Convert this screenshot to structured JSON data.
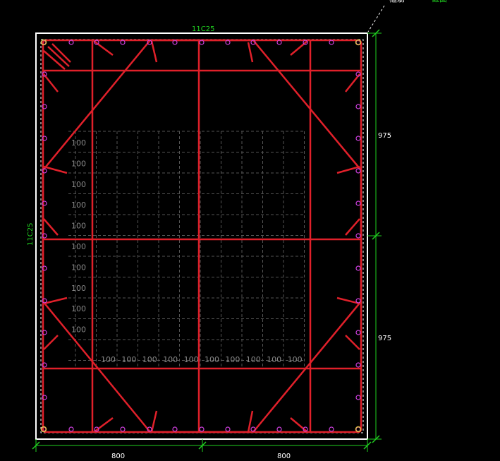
{
  "top_labels": {
    "left": "箍筋",
    "right": "截面"
  },
  "rebar_top": "11C25",
  "rebar_side": "11C25",
  "dims_right": [
    "975",
    "975"
  ],
  "dims_bottom": [
    "800",
    "800"
  ],
  "grid_label": "100",
  "colors": {
    "background": "#000000",
    "section": "#ffffff",
    "stirrup": "#e0202a",
    "bar": "#d040e0",
    "dim": "#20d020",
    "grid": "#6a6a6a",
    "text": "#ffffff"
  }
}
